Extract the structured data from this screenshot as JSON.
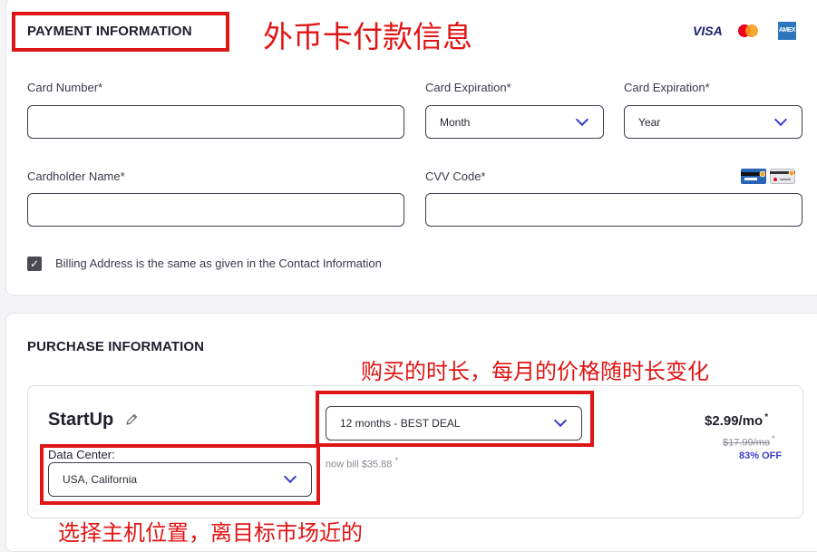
{
  "payment": {
    "title": "PAYMENT INFORMATION",
    "annotation": "外币卡付款信息",
    "card_logos": [
      "VISA",
      "mastercard",
      "AMEX"
    ],
    "card_number_label": "Card Number*",
    "card_number_value": "",
    "expiration_label_1": "Card Expiration*",
    "expiration_label_2": "Card Expiration*",
    "month_value": "Month",
    "year_value": "Year",
    "cardholder_label": "Cardholder Name*",
    "cardholder_value": "",
    "cvv_label": "CVV Code*",
    "cvv_value": "",
    "billing_checkbox_checked": true,
    "billing_checkbox_label": "Billing Address is the same as given in the Contact Information"
  },
  "purchase": {
    "title": "PURCHASE INFORMATION",
    "duration_annotation": "购买的时长，每月的价格随时长变化",
    "location_annotation": "选择主机位置，离目标市场近的",
    "plan_name": "StartUp",
    "term_value": "12 months - BEST DEAL",
    "bill_note": "now bill $35.88",
    "bill_note_mark": "*",
    "data_center_label": "Data Center:",
    "data_center_value": "USA, California",
    "price": "$2.99/mo",
    "price_mark": "*",
    "old_price": "$17.99/mo",
    "old_price_mark": "*",
    "discount": "83% OFF"
  },
  "colors": {
    "accent": "#3b3ec7",
    "annotation_red": "#e01515",
    "discount": "#3b3ec7"
  }
}
